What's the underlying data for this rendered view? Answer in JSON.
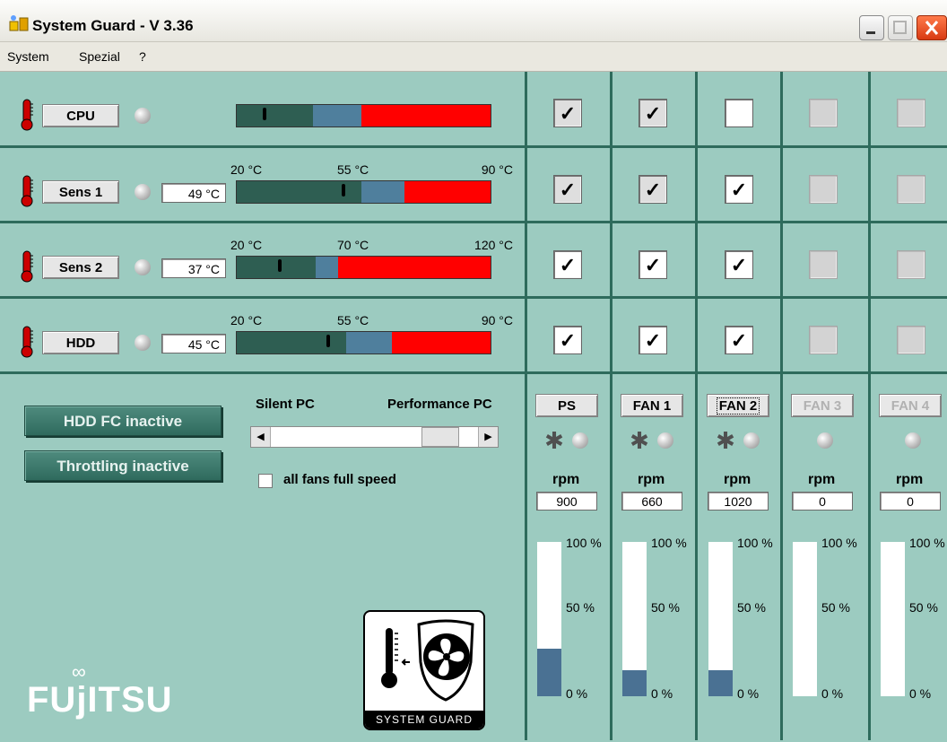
{
  "window": {
    "title": "System Guard - V 3.36"
  },
  "menu": [
    "System",
    "Spezial",
    "?"
  ],
  "sensors": [
    {
      "name": "CPU",
      "temp": "",
      "scale": [
        "",
        "",
        ""
      ],
      "level": 0.11,
      "green": 0.3,
      "blue": 0.19
    },
    {
      "name": "Sens 1",
      "temp": "49 °C",
      "scale": [
        "20 °C",
        "55 °C",
        "90 °C"
      ],
      "level": 0.42,
      "green": 0.49,
      "blue": 0.17
    },
    {
      "name": "Sens 2",
      "temp": "37 °C",
      "scale": [
        "20 °C",
        "70 °C",
        "120 °C"
      ],
      "level": 0.17,
      "green": 0.31,
      "blue": 0.09
    },
    {
      "name": "HDD",
      "temp": "45 °C",
      "scale": [
        "20 °C",
        "55 °C",
        "90 °C"
      ],
      "level": 0.36,
      "green": 0.43,
      "blue": 0.18
    }
  ],
  "checkgrid": [
    [
      "grey-checked",
      "grey-checked",
      "white-empty",
      "disabled",
      "disabled"
    ],
    [
      "grey-checked",
      "grey-checked",
      "white-checked",
      "disabled",
      "disabled"
    ],
    [
      "white-checked",
      "white-checked",
      "white-checked",
      "disabled",
      "disabled"
    ],
    [
      "white-checked",
      "white-checked",
      "white-checked",
      "disabled",
      "disabled"
    ]
  ],
  "status_buttons": {
    "hdd_fc": "HDD FC inactive",
    "throttling": "Throttling inactive"
  },
  "mode": {
    "silent": "Silent PC",
    "performance": "Performance PC",
    "position": 0.88
  },
  "fullspeed": {
    "label": "all fans full speed",
    "checked": false
  },
  "fans": [
    {
      "label": "PS",
      "rpm_label": "rpm",
      "rpm": "900",
      "fill": 0.31,
      "enabled": true
    },
    {
      "label": "FAN 1",
      "rpm_label": "rpm",
      "rpm": "660",
      "fill": 0.17,
      "enabled": true
    },
    {
      "label": "FAN 2",
      "rpm_label": "rpm",
      "rpm": "1020",
      "fill": 0.17,
      "enabled": true
    },
    {
      "label": "FAN 3",
      "rpm_label": "rpm",
      "rpm": "0",
      "fill": 0,
      "enabled": false
    },
    {
      "label": "FAN 4",
      "rpm_label": "rpm",
      "rpm": "0",
      "fill": 0,
      "enabled": false
    }
  ],
  "gauge_labels": {
    "top": "100 %",
    "mid": "50 %",
    "bottom": "0 %"
  },
  "branding": {
    "vendor": "FUjITSU",
    "product": "SYSTEM GUARD"
  },
  "colors": {
    "bar_green": "#2e5e52",
    "bar_blue": "#4f7f9d",
    "bar_red": "#ff0000",
    "gauge_fill": "#4a7193",
    "panel_bg": "#9ccbc0"
  }
}
